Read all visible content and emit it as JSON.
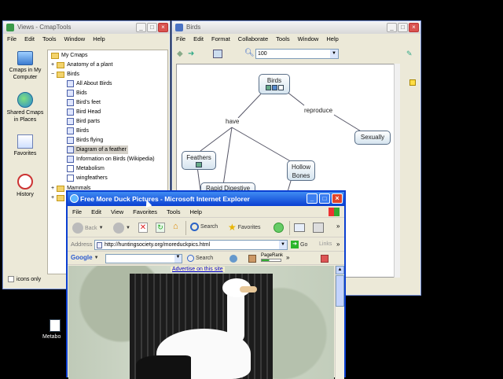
{
  "views_window": {
    "title": "Views - CmapTools",
    "menu": [
      "File",
      "Edit",
      "Tools",
      "Window",
      "Help"
    ],
    "nav": [
      "Cmaps in My Computer",
      "Shared Cmaps in Places",
      "Favorites",
      "History"
    ],
    "tree": {
      "root": "My Cmaps",
      "folders_top": [
        "Anatomy of a plant",
        "Birds"
      ],
      "birds_items": [
        "All About Birds",
        "Bids",
        "Bird's feet",
        "Bird Head",
        "Bird parts",
        "Birds",
        "Birds flying",
        "Diagram of a feather",
        "Information on Birds (Wikipedia)",
        "Metabolism",
        "wingfeathers"
      ],
      "folders_bottom": [
        "Mammals"
      ],
      "selected": "Diagram of a feather"
    },
    "icons_only_label": "icons only"
  },
  "birds_window": {
    "title": "Birds",
    "menu": [
      "File",
      "Edit",
      "Format",
      "Collaborate",
      "Tools",
      "Window",
      "Help"
    ],
    "zoom": "100",
    "concepts": {
      "birds": "Birds",
      "feathers": "Feathers",
      "hollow_bones": "Hollow Bones",
      "rapid_digestive": "Rapid Digestive",
      "sexually": "Sexually"
    },
    "links": {
      "have": "have",
      "reproduce": "reproduce"
    }
  },
  "ie_window": {
    "title": "Free More Duck Pictures - Microsoft Internet Explorer",
    "menu": [
      "File",
      "Edit",
      "View",
      "Favorites",
      "Tools",
      "Help"
    ],
    "toolbar": {
      "back": "Back",
      "search": "Search",
      "favorites": "Favorites"
    },
    "address_label": "Address",
    "address_value": "http://huntingsociety.org/moreduckpics.html",
    "go": "Go",
    "links": "Links",
    "google_label": "Google",
    "google_search": "Search",
    "pagerank": "PageRank",
    "advertise": "Advertise on this site"
  },
  "desktop": {
    "icon_label": "Metabo"
  },
  "colors": {
    "ie_title_top": "#3f8cf3",
    "ie_title_bottom": "#0a3fd1",
    "selection": "#d4d0c8",
    "node_border": "#5a6f88"
  }
}
